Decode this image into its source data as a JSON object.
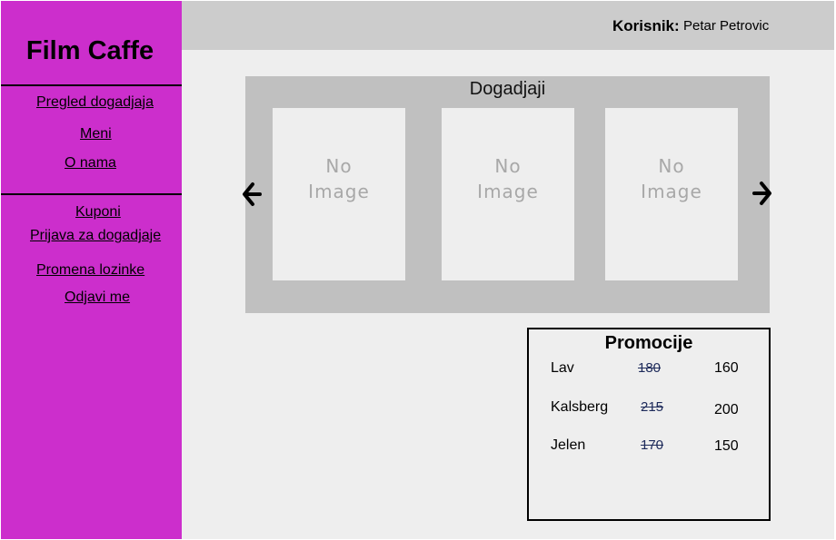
{
  "sidebar": {
    "brand": "Film Caffe",
    "links_top": [
      "Pregled dogadjaja",
      "Meni",
      "O nama"
    ],
    "links_bottom": [
      "Kuponi",
      "Prijava za dogadjaje",
      "Promena lozinke",
      "Odjavi me"
    ]
  },
  "header": {
    "user_label": "Korisnik:",
    "user_name": "Petar Petrovic"
  },
  "events": {
    "title": "Dogadjaji",
    "cards": [
      {
        "placeholder_line1": "No",
        "placeholder_line2": "Image"
      },
      {
        "placeholder_line1": "No",
        "placeholder_line2": "Image"
      },
      {
        "placeholder_line1": "No",
        "placeholder_line2": "Image"
      }
    ],
    "prev_icon": "arrow-left-icon",
    "next_icon": "arrow-right-icon"
  },
  "promotions": {
    "title": "Promocije",
    "items": [
      {
        "name": "Lav",
        "old_price": "180",
        "new_price": "160"
      },
      {
        "name": "Kalsberg",
        "old_price": "215",
        "new_price": "200"
      },
      {
        "name": "Jelen",
        "old_price": "170",
        "new_price": "150"
      }
    ]
  },
  "colors": {
    "sidebar": "#cc2ecc",
    "topbar": "#cccccc",
    "content": "#eeeeee",
    "events_panel": "#c0c0c0",
    "strike": "#1d2a5a"
  }
}
